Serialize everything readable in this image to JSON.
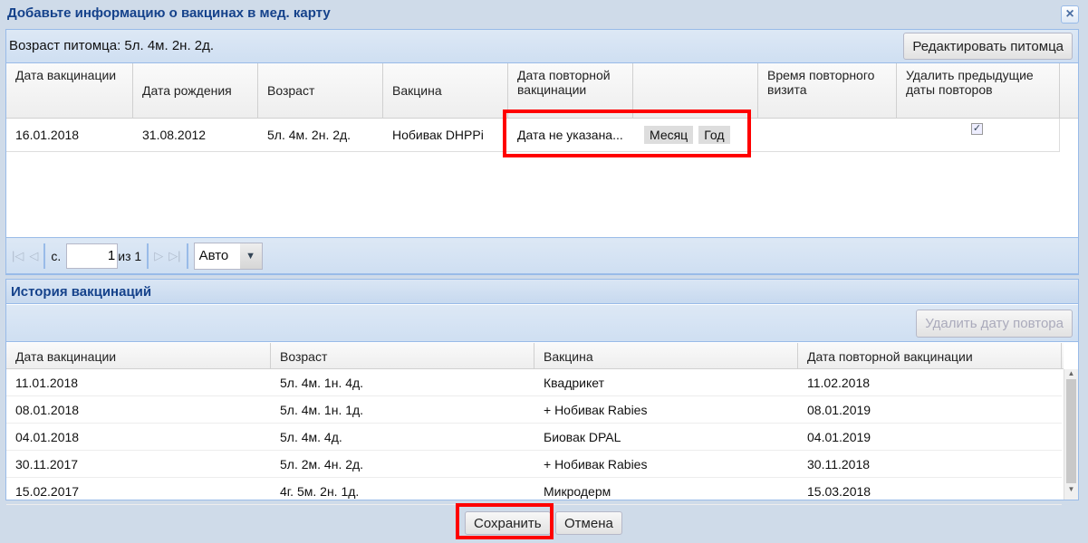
{
  "dialog": {
    "title": "Добавьте информацию о вакцинах в мед. карту",
    "close_icon": "close-icon"
  },
  "toolbar": {
    "pet_age": "Возраст питомца: 5л. 4м. 2н. 2д.",
    "edit_pet": "Редактировать питомца"
  },
  "vacc_grid": {
    "columns": [
      "Дата вакцинации",
      "Дата рождения",
      "Возраст",
      "Вакцина",
      "Дата повторной вакцинации",
      "",
      "Время повторного визита",
      "Удалить предыдущие даты повторов"
    ],
    "row": {
      "date": "16.01.2018",
      "birth": "31.08.2012",
      "age": "5л. 4м. 2н. 2д.",
      "vaccine": "Нобивак DHPPi",
      "revacc": "Дата не указана...",
      "month_btn": "Месяц",
      "year_btn": "Год",
      "visit_time": "",
      "delete_prev": true
    }
  },
  "paging": {
    "page_label": "с.",
    "page": "1",
    "of": "из 1",
    "size": "Авто"
  },
  "history": {
    "title": "История вакцинаций",
    "delete_btn": "Удалить дату повтора",
    "columns": [
      "Дата вакцинации",
      "Возраст",
      "Вакцина",
      "Дата повторной вакцинации"
    ],
    "rows": [
      [
        "11.01.2018",
        "5л. 4м. 1н. 4д.",
        "Квадрикет",
        "11.02.2018"
      ],
      [
        "08.01.2018",
        "5л. 4м. 1н. 1д.",
        "+ Нобивак Rabies",
        "08.01.2019"
      ],
      [
        "04.01.2018",
        "5л. 4м. 4д.",
        "Биовак DPAL",
        "04.01.2019"
      ],
      [
        "30.11.2017",
        "5л. 2м. 4н. 2д.",
        "+ Нобивак Rabies",
        "30.11.2018"
      ],
      [
        "15.02.2017",
        "4г. 5м. 2н. 1д.",
        "Микродерм",
        "15.03.2018"
      ]
    ]
  },
  "footer": {
    "save": "Сохранить",
    "cancel": "Отмена"
  }
}
